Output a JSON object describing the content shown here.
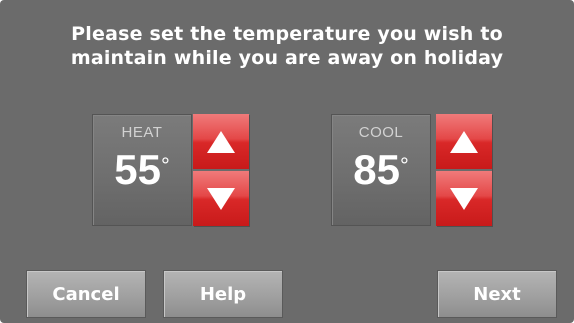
{
  "instruction": {
    "line1": "Please set the temperature you wish to",
    "line2": "maintain while you are away on holiday"
  },
  "heat": {
    "label": "HEAT",
    "value": "55",
    "unit": "°",
    "up_icon": "triangle-up-icon",
    "down_icon": "triangle-down-icon"
  },
  "cool": {
    "label": "COOL",
    "value": "85",
    "unit": "°",
    "up_icon": "triangle-up-icon",
    "down_icon": "triangle-down-icon"
  },
  "buttons": {
    "cancel": "Cancel",
    "help": "Help",
    "next": "Next"
  },
  "colors": {
    "background": "#6b6b6b",
    "stepper_red": "#d92828",
    "button_gray": "#a2a2a2",
    "text": "#ffffff"
  }
}
